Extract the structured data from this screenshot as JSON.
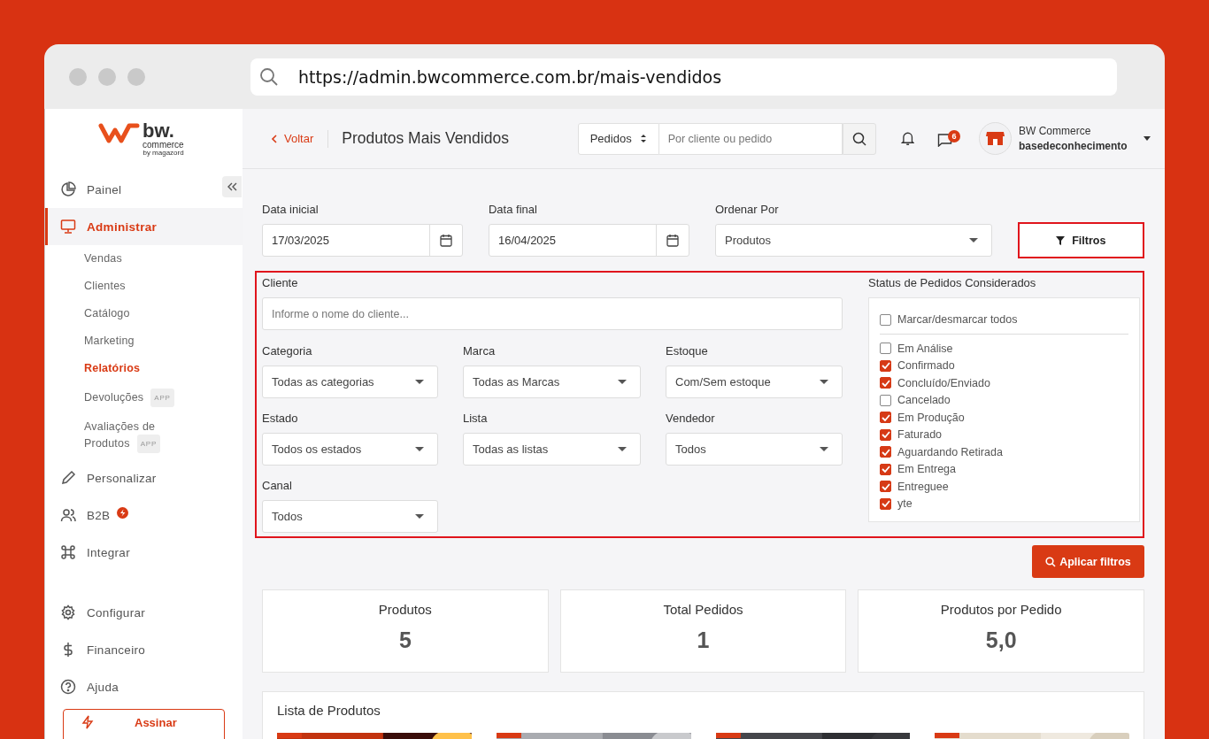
{
  "browser": {
    "url": "https://admin.bwcommerce.com.br/mais-vendidos"
  },
  "sidebar": {
    "logo": {
      "wordmark": "bw.",
      "sub": "commerce",
      "byline": "by magazord"
    },
    "items": [
      {
        "label": "Painel",
        "selected": false,
        "badge": false
      },
      {
        "label": "Administrar",
        "selected": true,
        "badge": false,
        "children": [
          {
            "label": "Vendas",
            "selected": false
          },
          {
            "label": "Clientes",
            "selected": false
          },
          {
            "label": "Catálogo",
            "selected": false
          },
          {
            "label": "Marketing",
            "selected": false
          },
          {
            "label": "Relatórios",
            "selected": true
          },
          {
            "label": "Devoluções",
            "selected": false,
            "tag": "APP"
          },
          {
            "label": "Avaliações de Produtos",
            "selected": false,
            "tag": "APP"
          }
        ]
      },
      {
        "label": "Personalizar",
        "selected": false,
        "badge": false
      },
      {
        "label": "B2B",
        "selected": false,
        "badge": true
      },
      {
        "label": "Integrar",
        "selected": false,
        "badge": false
      }
    ],
    "bottom_items": [
      {
        "label": "Configurar",
        "selected": false
      },
      {
        "label": "Financeiro",
        "selected": false
      },
      {
        "label": "Ajuda",
        "selected": false
      }
    ],
    "subscribe_button": "Assinar"
  },
  "header": {
    "back_link": "Voltar",
    "title": "Produtos Mais Vendidos",
    "search": {
      "scope": "Pedidos",
      "placeholder": "Por cliente ou pedido"
    },
    "messages_badge": "6",
    "account": {
      "name": "BW Commerce",
      "store": "basedeconhecimento"
    }
  },
  "filters": {
    "date_start": {
      "label": "Data inicial",
      "value": "17/03/2025"
    },
    "date_end": {
      "label": "Data final",
      "value": "16/04/2025"
    },
    "order_by": {
      "label": "Ordenar Por",
      "value": "Produtos"
    },
    "filter_button": {
      "label": "Filtros",
      "highlighted": true
    },
    "panel": {
      "highlighted": true,
      "client": {
        "label": "Cliente",
        "placeholder": "Informe o nome do cliente..."
      },
      "selects": [
        {
          "label": "Categoria",
          "value": "Todas as categorias"
        },
        {
          "label": "Marca",
          "value": "Todas as Marcas"
        },
        {
          "label": "Estoque",
          "value": "Com/Sem estoque"
        },
        {
          "label": "Estado",
          "value": "Todos os estados"
        },
        {
          "label": "Lista",
          "value": "Todas as listas"
        },
        {
          "label": "Vendedor",
          "value": "Todos"
        },
        {
          "label": "Canal",
          "value": "Todos"
        }
      ],
      "status": {
        "title": "Status de Pedidos Considerados",
        "select_all": {
          "label": "Marcar/desmarcar todos",
          "checked": false
        },
        "items": [
          {
            "label": "Em Análise",
            "checked": false
          },
          {
            "label": "Confirmado",
            "checked": true
          },
          {
            "label": "Concluído/Enviado",
            "checked": true
          },
          {
            "label": "Cancelado",
            "checked": false
          },
          {
            "label": "Em Produção",
            "checked": true
          },
          {
            "label": "Faturado",
            "checked": true
          },
          {
            "label": "Aguardando Retirada",
            "checked": true
          },
          {
            "label": "Em Entrega",
            "checked": true
          },
          {
            "label": "Entreguee",
            "checked": true
          },
          {
            "label": "yte",
            "checked": true
          }
        ]
      }
    },
    "apply_button": "Aplicar filtros"
  },
  "stats": [
    {
      "label": "Produtos",
      "value": "5"
    },
    {
      "label": "Total Pedidos",
      "value": "1"
    },
    {
      "label": "Produtos por Pedido",
      "value": "5,0"
    }
  ],
  "products": {
    "title": "Lista de Produtos"
  }
}
